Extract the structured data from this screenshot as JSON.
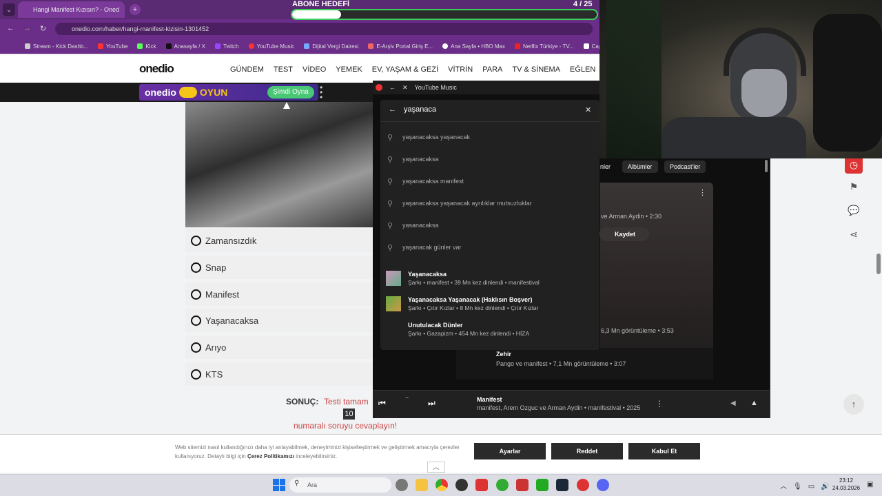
{
  "browser": {
    "tab_title": "Hangi Manifest Kızısın? - Oned",
    "url": "onedio.com/haber/hangi-manifest-kizisin-1301452",
    "bookmarks": [
      "Stream - Kick Dashb...",
      "YouTube",
      "Kick",
      "Anasayfa / X",
      "Twitch",
      "YouTube Music",
      "Dijital Vergi Dairesi",
      "E-Arşiv Portal Giriş E...",
      "Ana Sayfa • HBO Max",
      "Netflix Türkiye - TV...",
      "CapCu"
    ]
  },
  "site": {
    "logo": "onedio",
    "nav": [
      "GÜNDEM",
      "TEST",
      "VİDEO",
      "YEMEK",
      "EV, YAŞAM & GEZİ",
      "VİTRİN",
      "PARA",
      "TV & SİNEMA",
      "EĞLEN"
    ],
    "banner_logo": "onedio",
    "banner_label": "OYUN",
    "banner_button": "Şimdi Oyna"
  },
  "quiz": {
    "options": [
      "Zamansızdık",
      "Snap",
      "Manifest",
      "Yaşanacaksa",
      "Arıyo",
      "KTS"
    ],
    "result_label": "SONUÇ:",
    "result_text": "Testi tamam",
    "result_number": "10",
    "result_sub": "numaralı soruyu cevaplayın!"
  },
  "cookie": {
    "text_pre": "Web sitemizi nasıl kullandığınızı daha iyi anlayabilmek, deneyiminizi kişiselleştirmek ve geliştirmek amacıyla çerezler kullanıyoruz. Detaylı bilgi için ",
    "policy_link": "Çerez Politikamızı",
    "text_post": " inceleyebilirsiniz.",
    "settings": "Ayarlar",
    "reject": "Reddet",
    "accept": "Kabul Et"
  },
  "goal": {
    "label": "ABONE HEDEFİ",
    "count": "4  / 25",
    "progress": 0.16
  },
  "ytm": {
    "window_title": "YouTube Music",
    "query": "yaşanaca",
    "suggestions": [
      "yaşanacaksa yaşanacak",
      "yaşanacaksa",
      "yaşanacaksa manifest",
      "yaşanacaksa yaşanacak ayrılıklar mutsuzluklar",
      "yasanacaksa",
      "yaşanacak günler var"
    ],
    "results": [
      {
        "title": "Yaşanacaksa",
        "sub": "Şarkı • manifest • 39 Mn kez dinlendi • manifestival"
      },
      {
        "title": "Yaşanacaksa Yaşanacak (Haklısın Boşver)",
        "sub": "Şarkı • Çıtır Kızlar • 8 Mn kez dinlendi • Çıtır Kızlar"
      },
      {
        "title": "Unutulacak Dünler",
        "sub": "Şarkı • Gazapizm • 454 Mn kez dinlendi • HİZA"
      }
    ],
    "chips": [
      "nler",
      "Albümler",
      "Podcast'ler"
    ],
    "card_meta": "ve Arman Aydin • 2:30",
    "save_label": "Kaydet",
    "views_meta": "6,3 Mn görüntüleme • 3:53",
    "next_title": "Zehir",
    "next_meta": "Pango ve manifest • 7,1 Mn görüntüleme • 3:07",
    "now_playing_title": "Manifest",
    "now_playing_meta": "manifest, Arem Ozguc ve Arman Aydin • manifestival • 2025"
  },
  "taskbar": {
    "search": "Ara",
    "time": "23:12",
    "date": "24.03.2026"
  }
}
